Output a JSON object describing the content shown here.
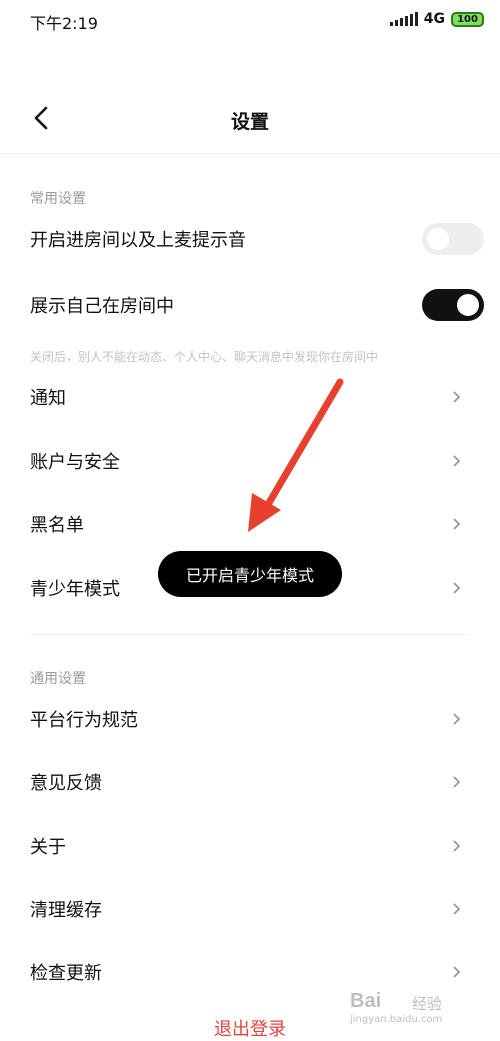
{
  "status_bar": {
    "time": "下午2:19",
    "network": "4G",
    "battery": "100"
  },
  "header": {
    "title": "设置"
  },
  "common_settings": {
    "header": "常用设置",
    "toggle_entry_sound": {
      "label": "开启进房间以及上麦提示音",
      "on": false
    },
    "toggle_show_in_room": {
      "label": "展示自己在房间中",
      "on": true
    },
    "hint": "关闭后，别人不能在动态、个人中心、聊天消息中发现你在房间中",
    "items": [
      {
        "label": "通知"
      },
      {
        "label": "账户与安全"
      },
      {
        "label": "黑名单"
      },
      {
        "label": "青少年模式"
      }
    ]
  },
  "general_settings": {
    "header": "通用设置",
    "items": [
      {
        "label": "平台行为规范"
      },
      {
        "label": "意见反馈"
      },
      {
        "label": "关于"
      },
      {
        "label": "清理缓存"
      },
      {
        "label": "检查更新"
      }
    ]
  },
  "logout_label": "退出登录",
  "toast": "已开启青少年模式",
  "colors": {
    "logout": "#e2453c",
    "annotation_arrow": "#e8402f",
    "toggle_on": "#111111",
    "toggle_off": "#eeeeee"
  },
  "watermark": {
    "logo": "Bai",
    "text": "经验",
    "url": "jingyan.baidu.com"
  }
}
